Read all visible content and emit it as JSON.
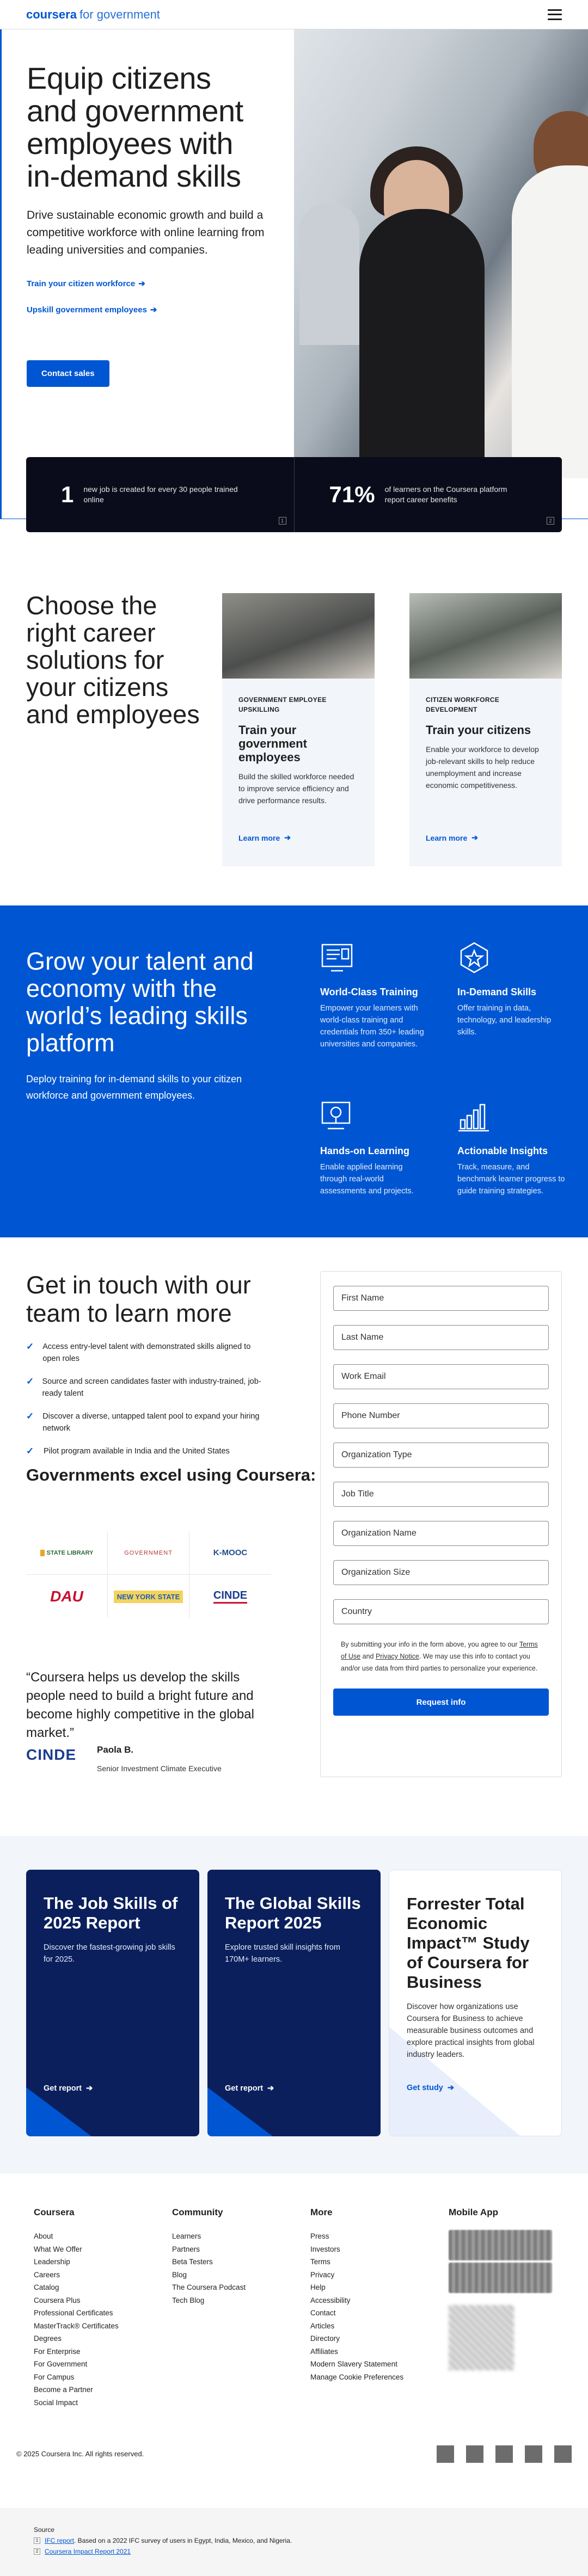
{
  "header": {
    "brand": "coursera",
    "sub": "for government"
  },
  "hero": {
    "title": "Equip citizens and government employees with in-demand skills",
    "lead": "Drive sustainable economic growth and build a competitive workforce with online learning from leading universities and companies.",
    "link1": "Train your citizen workforce",
    "link2": "Upskill government employees",
    "cta": "Contact sales",
    "stats": [
      {
        "num": "1",
        "text": "new job is created for every 30 people trained online",
        "ref": "1"
      },
      {
        "num": "71%",
        "text": "of learners on the Coursera platform report career benefits",
        "ref": "2"
      }
    ]
  },
  "solutions": {
    "title": "Choose the right career solutions for your citizens and employees",
    "cards": [
      {
        "kicker": "GOVERNMENT EMPLOYEE UPSKILLING",
        "title": "Train your government employees",
        "text": "Build the skilled workforce needed to improve service efficiency and drive performance results.",
        "more": "Learn more"
      },
      {
        "kicker": "CITIZEN WORKFORCE DEVELOPMENT",
        "title": "Train your citizens",
        "text": "Enable your workforce to develop job-relevant skills to help reduce unemployment and increase economic competitiveness.",
        "more": "Learn more"
      }
    ]
  },
  "band": {
    "title": "Grow your talent and economy with the world’s leading skills platform",
    "lead": "Deploy training for in-demand skills to your citizen workforce and government employees.",
    "features": [
      {
        "icon": "training-screen-icon",
        "title": "World-Class Training",
        "text": "Empower your learners with world-class training and credentials from 350+ leading universities and companies."
      },
      {
        "icon": "star-badge-icon",
        "title": "In-Demand Skills",
        "text": "Offer training in data, technology, and leadership skills."
      },
      {
        "icon": "hands-on-monitor-icon",
        "title": "Hands-on Learning",
        "text": "Enable applied learning through real-world assessments and projects."
      },
      {
        "icon": "bar-chart-icon",
        "title": "Actionable Insights",
        "text": "Track, measure, and benchmark learner progress to guide training strategies."
      }
    ]
  },
  "contact": {
    "title": "Get in touch with our team to learn more",
    "checks": [
      "Access entry-level talent with demonstrated skills aligned to open roles",
      "Source and screen candidates faster with industry-trained, job-ready talent",
      "Discover a diverse, untapped talent pool to expand your hiring network",
      "Pilot program available in India and the United States"
    ],
    "gov_title": "Governments excel using Coursera:",
    "logos": [
      "STATE LIBRARY",
      "GOVERNMENT",
      "K-MOOC",
      "DAU",
      "NEW YORK STATE",
      "CINDE"
    ],
    "quote": "“Coursera helps us develop the skills people need to build a bright future and become highly competitive in the global market.”",
    "quote_logo": "CINDE",
    "quote_name": "Paola B.",
    "quote_role": "Senior Investment Climate Executive",
    "form": {
      "fields": [
        "First Name",
        "Last Name",
        "Work Email",
        "Phone Number",
        "Organization Type",
        "Job Title",
        "Organization Name",
        "Organization Size",
        "Country"
      ],
      "fine_a": "By submitting your info in the form above, you agree to our ",
      "fine_terms": "Terms of Use",
      "fine_and": " and ",
      "fine_privacy": "Privacy Notice",
      "fine_b": ". We may use this info to contact you and/or use data from third parties to personalize your experience.",
      "submit": "Request info"
    }
  },
  "reports": [
    {
      "title": "The Job Skills of 2025 Report",
      "text": "Discover the fastest-growing job skills for 2025.",
      "go": "Get report"
    },
    {
      "title": "The Global Skills Report 2025",
      "text": "Explore trusted skill insights from 170M+ learners.",
      "go": "Get report"
    },
    {
      "title": "Forrester Total Economic Impact™ Study of Coursera for Business",
      "text": "Discover how organizations use Coursera for Business to achieve measurable business outcomes and explore practical insights from global industry leaders.",
      "go": "Get study"
    }
  ],
  "footer": {
    "coursera": {
      "h": "Coursera",
      "items": [
        "About",
        "What We Offer",
        "Leadership",
        "Careers",
        "Catalog",
        "Coursera Plus",
        "Professional Certificates",
        "MasterTrack® Certificates",
        "Degrees",
        "For Enterprise",
        "For Government",
        "For Campus",
        "Become a Partner",
        "Social Impact"
      ]
    },
    "community": {
      "h": "Community",
      "items": [
        "Learners",
        "Partners",
        "Beta Testers",
        "Blog",
        "The Coursera Podcast",
        "Tech Blog"
      ]
    },
    "more": {
      "h": "More",
      "items": [
        "Press",
        "Investors",
        "Terms",
        "Privacy",
        "Help",
        "Accessibility",
        "Contact",
        "Articles",
        "Directory",
        "Affiliates",
        "Modern Slavery Statement",
        "Manage Cookie Preferences"
      ]
    },
    "mobile": {
      "h": "Mobile App"
    },
    "copyright": "© 2025 Coursera Inc. All rights reserved."
  },
  "sources": {
    "h": "Source",
    "s1_link": "IFC report",
    "s1_text": ". Based on a 2022 IFC survey of users in Egypt, India, Mexico, and Nigeria.",
    "s2_link": "Coursera Impact Report 2021"
  }
}
